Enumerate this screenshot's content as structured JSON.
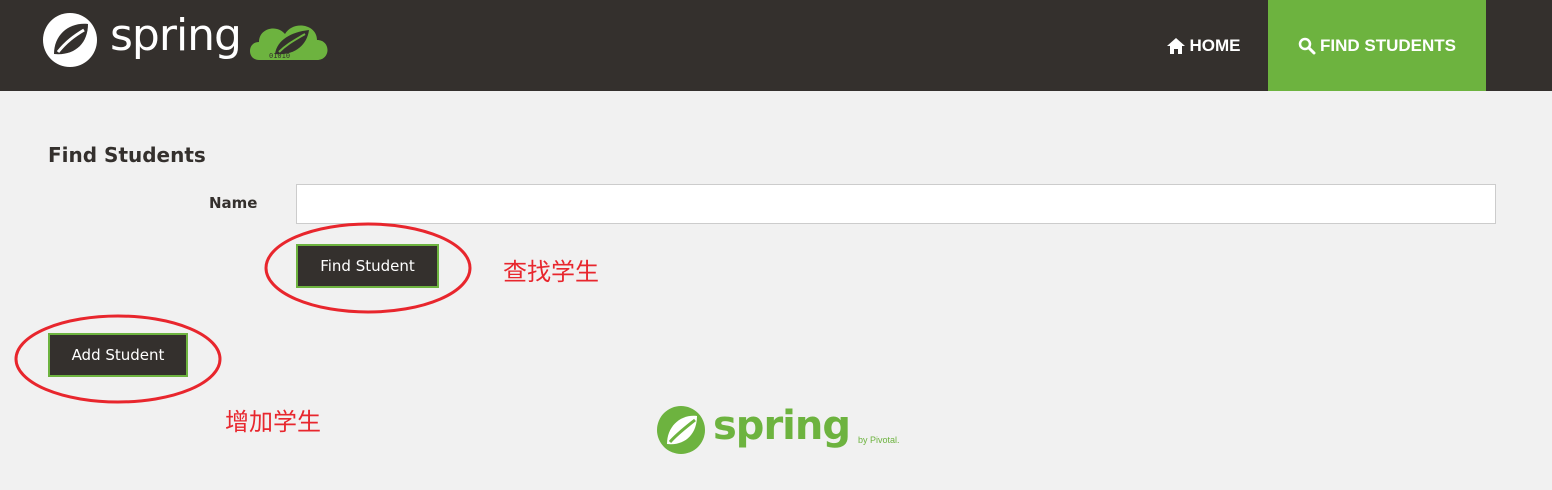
{
  "header": {
    "brand_text": "spring",
    "cloud_badge": "01010",
    "nav": [
      {
        "label": "HOME",
        "icon": "home-icon",
        "active": false
      },
      {
        "label": "FIND STUDENTS",
        "icon": "search-icon",
        "active": true
      }
    ]
  },
  "main": {
    "title": "Find Students",
    "name_label": "Name",
    "name_value": "",
    "find_button": "Find Student",
    "add_button": "Add Student"
  },
  "annotations": {
    "find_note": "查找学生",
    "add_note": "增加学生",
    "color": "#e8262d"
  },
  "footer": {
    "brand_text": "spring",
    "by_text": "by Pivotal."
  },
  "colors": {
    "navbar": "#34302d",
    "accent": "#6db33f",
    "background": "#f1f1f1"
  }
}
